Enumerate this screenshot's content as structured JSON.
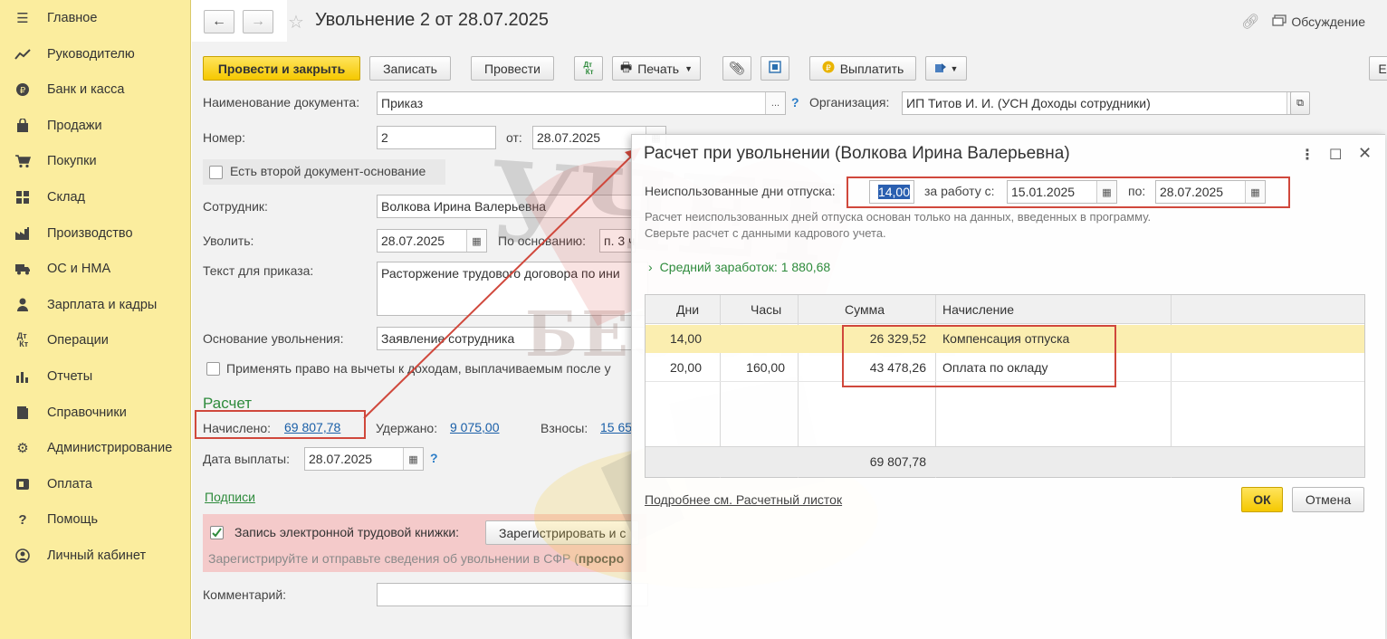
{
  "sidebar": {
    "items": [
      {
        "label": "Главное",
        "icon": "menu-icon"
      },
      {
        "label": "Руководителю",
        "icon": "trend-icon"
      },
      {
        "label": "Банк и касса",
        "icon": "coin-icon"
      },
      {
        "label": "Продажи",
        "icon": "bag-icon"
      },
      {
        "label": "Покупки",
        "icon": "cart-icon"
      },
      {
        "label": "Склад",
        "icon": "warehouse-icon"
      },
      {
        "label": "Производство",
        "icon": "factory-icon"
      },
      {
        "label": "ОС и НМА",
        "icon": "truck-icon"
      },
      {
        "label": "Зарплата и кадры",
        "icon": "person-icon"
      },
      {
        "label": "Операции",
        "icon": "dt-kt-icon"
      },
      {
        "label": "Отчеты",
        "icon": "bar-chart-icon"
      },
      {
        "label": "Справочники",
        "icon": "book-icon"
      },
      {
        "label": "Администрирование",
        "icon": "gear-icon"
      },
      {
        "label": "Оплата",
        "icon": "payment-icon"
      },
      {
        "label": "Помощь",
        "icon": "question-icon"
      },
      {
        "label": "Личный кабинет",
        "icon": "user-circle-icon"
      }
    ]
  },
  "header": {
    "title": "Увольнение 2 от 28.07.2025",
    "discussion": "Обсуждение"
  },
  "toolbar": {
    "post_close": "Провести и закрыть",
    "save": "Записать",
    "post": "Провести",
    "dt_kt": "Дт Кт",
    "print": "Печать",
    "pay": "Выплатить"
  },
  "form": {
    "doc_name_label": "Наименование документа:",
    "doc_name": "Приказ",
    "org_label": "Организация:",
    "org": "ИП Титов И. И. (УСН Доходы сотрудники)",
    "number_label": "Номер:",
    "number": "2",
    "from_label": "от:",
    "date": "28.07.2025",
    "second_doc": "Есть второй документ-основание",
    "employee_label": "Сотрудник:",
    "employee": "Волкова Ирина Валерьевна",
    "dismiss_label": "Уволить:",
    "dismiss_date": "28.07.2025",
    "basis_label": "По основанию:",
    "basis": "п. 3 ч",
    "order_text_label": "Текст для приказа:",
    "order_text": "Расторжение трудового договора по ини",
    "reason_label": "Основание увольнения:",
    "reason": "Заявление сотрудника",
    "deductions": "Применять право на вычеты к доходам, выплачиваемым после у",
    "calc_title": "Расчет",
    "accrued_label": "Начислено:",
    "accrued": "69 807,78",
    "withheld_label": "Удержано:",
    "withheld": "9 075,00",
    "contrib_label": "Взносы:",
    "contrib": "15 65",
    "pay_date_label": "Дата выплаты:",
    "pay_date": "28.07.2025",
    "signatures": "Подписи",
    "etk_label": "Запись электронной трудовой книжки:",
    "etk_button": "Зарегистрировать и с",
    "etk_note_prefix": "Зарегистрируйте и отправьте сведения об увольнении в СФР (",
    "etk_note_bold": "просро",
    "comment_label": "Комментарий:"
  },
  "watermark": {
    "line1": "УЧЕТ",
    "line2": "БЕЗ ЗАБОТ"
  },
  "modal": {
    "title": "Расчет при увольнении (Волкова Ирина Валерьевна)",
    "unused_label": "Неиспользованные дни отпуска:",
    "unused_days": "14,00",
    "work_from_label": "за работу с:",
    "work_from": "15.01.2025",
    "to_label": "по:",
    "work_to": "28.07.2025",
    "note1": "Расчет неиспользованных дней отпуска основан только на данных, введенных в программу.",
    "note2": "Сверьте расчет с данными кадрового учета.",
    "avg_earnings": "Средний заработок: 1 880,68",
    "columns": [
      "Дни",
      "Часы",
      "Сумма",
      "Начисление"
    ],
    "rows": [
      {
        "days": "14,00",
        "hours": "",
        "sum": "26 329,52",
        "accrual": "Компенсация отпуска"
      },
      {
        "days": "20,00",
        "hours": "160,00",
        "sum": "43 478,26",
        "accrual": "Оплата по окладу"
      }
    ],
    "total": "69 807,78",
    "details_link": "Подробнее см. Расчетный листок",
    "ok": "ОК",
    "cancel": "Отмена"
  },
  "colors": {
    "sidebar_bg": "#fbed9e",
    "primary_button": "#f5c800",
    "highlight_row": "#fbeeb0",
    "annotation_red": "#d0483c",
    "green": "#2e8b3c",
    "link": "#1a5fa8"
  }
}
